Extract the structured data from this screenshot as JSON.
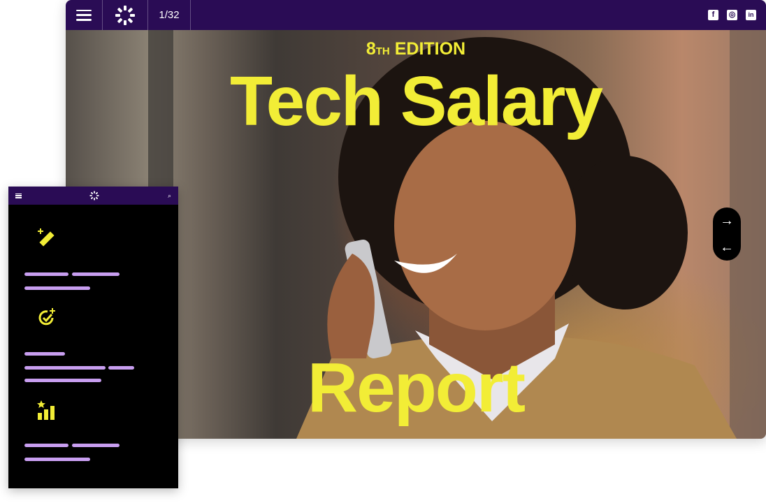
{
  "desktop": {
    "topbar": {
      "menu_icon": "hamburger-icon",
      "logo_icon": "brand-logo",
      "page_indicator": "1/32",
      "social": [
        "facebook-icon",
        "instagram-icon",
        "linkedin-icon"
      ],
      "social_glyphs": {
        "facebook": "f",
        "instagram": "◎",
        "linkedin": "in"
      }
    },
    "hero": {
      "edition_number": "8",
      "edition_suffix": "TH",
      "edition_word": "EDITION",
      "title_line1": "Tech Salary",
      "title_line2": "Report"
    },
    "nav": {
      "next_glyph": "→",
      "prev_glyph": "←"
    }
  },
  "mobile": {
    "menu_icon": "hamburger-icon",
    "logo_icon": "brand-logo",
    "search_glyph": "⌕",
    "sections": [
      {
        "icon": "magic-pencil-icon"
      },
      {
        "icon": "check-sparkle-icon"
      },
      {
        "icon": "star-bar-chart-icon"
      }
    ]
  },
  "colors": {
    "brand_purple": "#2a0c55",
    "accent_yellow": "#f2ed36",
    "placeholder_lilac": "#c89ef0",
    "mobile_background": "#000000"
  }
}
